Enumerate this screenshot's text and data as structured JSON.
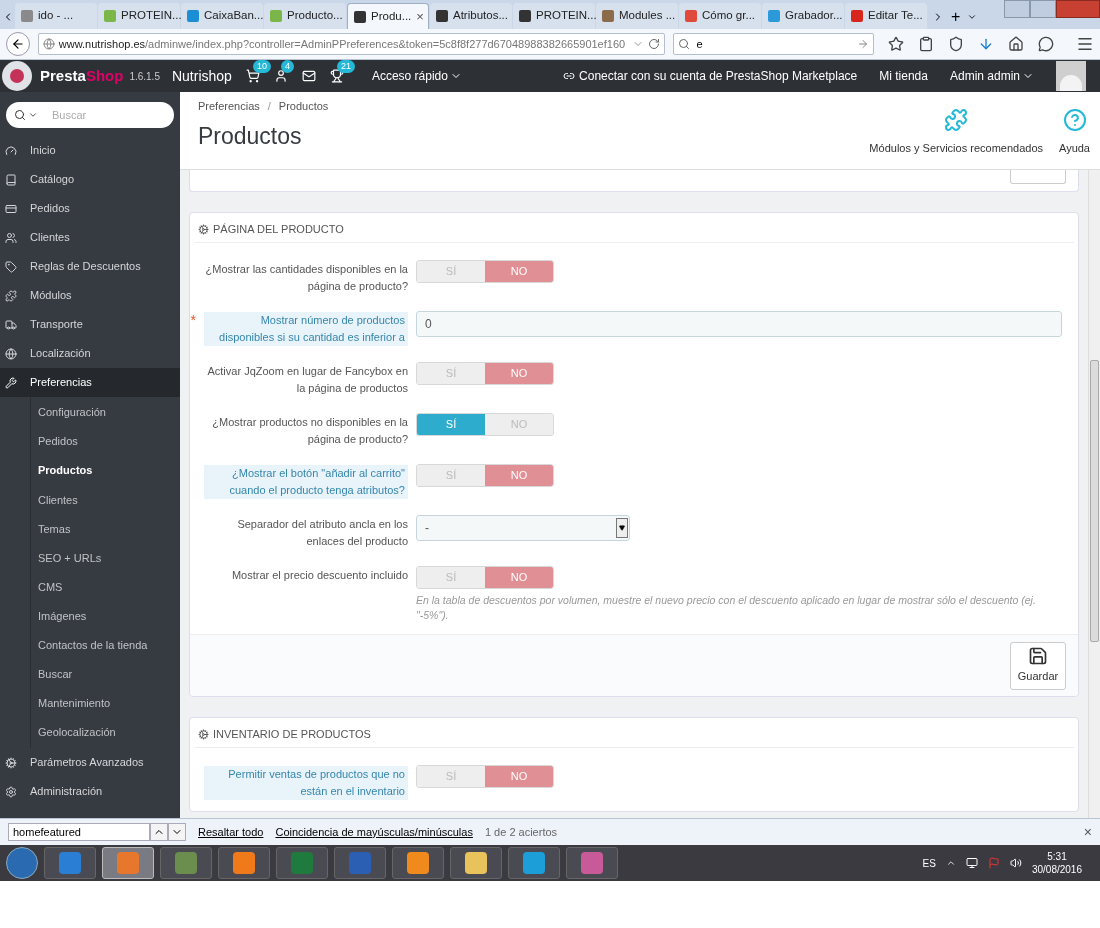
{
  "browser": {
    "tabs": [
      {
        "label": "ido - ...",
        "selected": false,
        "color": "#8a8a8a"
      },
      {
        "label": "PROTEIN...",
        "selected": false,
        "color": "#7ab648"
      },
      {
        "label": "CaixaBan...",
        "selected": false,
        "color": "#1a8fd6"
      },
      {
        "label": "Producto...",
        "selected": false,
        "color": "#7ab648"
      },
      {
        "label": "Produ...",
        "selected": true,
        "color": "#333333"
      },
      {
        "label": "Atributos...",
        "selected": false,
        "color": "#333333"
      },
      {
        "label": "PROTEIN...",
        "selected": false,
        "color": "#333333"
      },
      {
        "label": "Modules ...",
        "selected": false,
        "color": "#8b6b4a"
      },
      {
        "label": "Cómo gr...",
        "selected": false,
        "color": "#e04a3a"
      },
      {
        "label": "Grabador...",
        "selected": false,
        "color": "#2a9ad8"
      },
      {
        "label": "Editar Te...",
        "selected": false,
        "color": "#d7261c"
      }
    ],
    "close_tab": "×",
    "new_tab": "+",
    "url_host": "www.nutrishop.es",
    "url_path": "/adminwe/index.php?controller=AdminPPreferences&token=5c8f8f277d67048988382665901ef160",
    "search_value": "e"
  },
  "header": {
    "brand_first": "Presta",
    "brand_second": "Shop",
    "version": "1.6.1.5",
    "shop": "Nutrishop",
    "notifications": [
      {
        "kind": "cart",
        "count": "10"
      },
      {
        "kind": "user",
        "count": "4"
      },
      {
        "kind": "mail"
      },
      {
        "kind": "trophy",
        "count": "21"
      }
    ],
    "quick_access": "Acceso rápido",
    "marketplace": "Conectar con su cuenta de PrestaShop Marketplace",
    "my_shop": "Mi tienda",
    "admin": "Admin admin"
  },
  "sidebar": {
    "search_placeholder": "Buscar",
    "items": [
      {
        "label": "Inicio",
        "selected": false
      },
      {
        "label": "Catálogo",
        "selected": false
      },
      {
        "label": "Pedidos",
        "selected": false
      },
      {
        "label": "Clientes",
        "selected": false
      },
      {
        "label": "Reglas de Descuentos",
        "selected": false
      },
      {
        "label": "Módulos",
        "selected": false
      },
      {
        "label": "Transporte",
        "selected": false
      },
      {
        "label": "Localización",
        "selected": false
      },
      {
        "label": "Preferencias",
        "selected": true,
        "children": [
          {
            "label": "Configuración",
            "selected": false
          },
          {
            "label": "Pedidos",
            "selected": false
          },
          {
            "label": "Productos",
            "selected": true
          },
          {
            "label": "Clientes",
            "selected": false
          },
          {
            "label": "Temas",
            "selected": false
          },
          {
            "label": "SEO + URLs",
            "selected": false
          },
          {
            "label": "CMS",
            "selected": false
          },
          {
            "label": "Imágenes",
            "selected": false
          },
          {
            "label": "Contactos de la tienda",
            "selected": false
          },
          {
            "label": "Buscar",
            "selected": false
          },
          {
            "label": "Mantenimiento",
            "selected": false
          },
          {
            "label": "Geolocalización",
            "selected": false
          }
        ]
      },
      {
        "label": "Parámetros Avanzados",
        "selected": false
      },
      {
        "label": "Administración",
        "selected": false
      }
    ]
  },
  "page": {
    "breadcrumb": [
      "Preferencias",
      "Productos"
    ],
    "breadcrumb_separator": "/",
    "title": "Productos",
    "toolbar": [
      {
        "kind": "modules",
        "label": "Módulos y Servicios recomendados"
      },
      {
        "kind": "help",
        "label": "Ayuda"
      }
    ]
  },
  "panels": [
    {
      "title": "PÁGINA DEL PRODUCTO",
      "save_label": "Guardar",
      "rows": [
        {
          "kind": "toggle",
          "label": "¿Mostrar las cantidades disponibles en la página de producto?",
          "hint": false,
          "options": [
            {
              "label": "SÍ",
              "selected": false
            },
            {
              "label": "NO",
              "selected": true
            }
          ]
        },
        {
          "kind": "input",
          "label": "Mostrar número de productos disponibles si su cantidad es inferior a",
          "hint": true,
          "required_mark": "*",
          "value": "0"
        },
        {
          "kind": "toggle",
          "label": "Activar JqZoom en lugar de Fancybox en la página de productos",
          "hint": false,
          "options": [
            {
              "label": "SÍ",
              "selected": false
            },
            {
              "label": "NO",
              "selected": true
            }
          ]
        },
        {
          "kind": "toggle",
          "label": "¿Mostrar productos no disponibles en la página de producto?",
          "hint": false,
          "options": [
            {
              "label": "SÍ",
              "selected": true
            },
            {
              "label": "NO",
              "selected": false
            }
          ]
        },
        {
          "kind": "toggle",
          "label": "¿Mostrar el botón \"añadir al carrito\" cuando el producto tenga atributos?",
          "hint": true,
          "options": [
            {
              "label": "SÍ",
              "selected": false
            },
            {
              "label": "NO",
              "selected": true
            }
          ]
        },
        {
          "kind": "select",
          "label": "Separador del atributo ancla en los enlaces del producto",
          "hint": false,
          "value": "-"
        },
        {
          "kind": "toggle",
          "label": "Mostrar el precio descuento incluido",
          "hint": false,
          "options": [
            {
              "label": "SÍ",
              "selected": false
            },
            {
              "label": "NO",
              "selected": true
            }
          ],
          "help": "En la tabla de descuentos por volumen, muestre el nuevo precio con el descuento aplicado en lugar de mostrar sólo el descuento (ej. \"-5%\")."
        }
      ]
    },
    {
      "title": "INVENTARIO DE PRODUCTOS",
      "rows": [
        {
          "kind": "toggle",
          "label": "Permitir ventas de productos que no están en el inventario",
          "hint": true,
          "options": [
            {
              "label": "SÍ",
              "selected": false
            },
            {
              "label": "NO",
              "selected": true
            }
          ]
        }
      ]
    }
  ],
  "find_bar": {
    "value": "homefeatured",
    "highlight_all": "Resaltar todo",
    "match_case": "Coincidencia de mayúsculas/minúsculas",
    "result": "1 de 2 aciertos",
    "close": "×"
  },
  "taskbar": {
    "apps": [
      {
        "color": "#2a7fd4",
        "selected": false
      },
      {
        "color": "#e8772e",
        "selected": true
      },
      {
        "color": "#6b8e4e",
        "selected": false
      },
      {
        "color": "#f07a1a",
        "selected": false
      },
      {
        "color": "#1f7a3e",
        "selected": false
      },
      {
        "color": "#2b5fb4",
        "selected": false
      },
      {
        "color": "#f08a1c",
        "selected": false
      },
      {
        "color": "#e8c25a",
        "selected": false
      },
      {
        "color": "#1c9fd8",
        "selected": false
      },
      {
        "color": "#c85a9a",
        "selected": false
      }
    ],
    "language": "ES",
    "time": "5:31",
    "date": "30/08/2016"
  }
}
